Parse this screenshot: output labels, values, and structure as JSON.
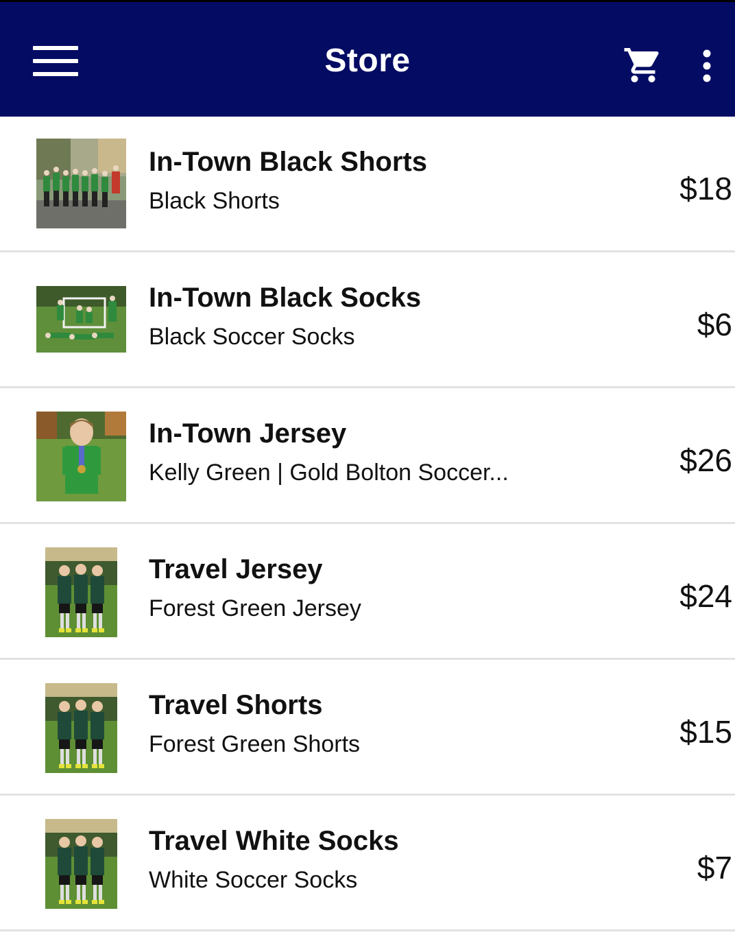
{
  "appbar": {
    "title": "Store",
    "menu_icon": "hamburger-menu-icon",
    "cart_icon": "shopping-cart-icon",
    "more_icon": "more-vertical-icon",
    "background": "#030b63"
  },
  "products": [
    {
      "name": "In-Town Black Shorts",
      "description": "Black Shorts",
      "price": "$18"
    },
    {
      "name": "In-Town Black Socks",
      "description": "Black Soccer Socks",
      "price": "$6"
    },
    {
      "name": "In-Town Jersey",
      "description": "Kelly Green | Gold Bolton Soccer...",
      "price": "$26"
    },
    {
      "name": "Travel Jersey",
      "description": "Forest Green Jersey",
      "price": "$24"
    },
    {
      "name": "Travel Shorts",
      "description": "Forest Green Shorts",
      "price": "$15"
    },
    {
      "name": "Travel White Socks",
      "description": "White Soccer Socks",
      "price": "$7"
    }
  ]
}
